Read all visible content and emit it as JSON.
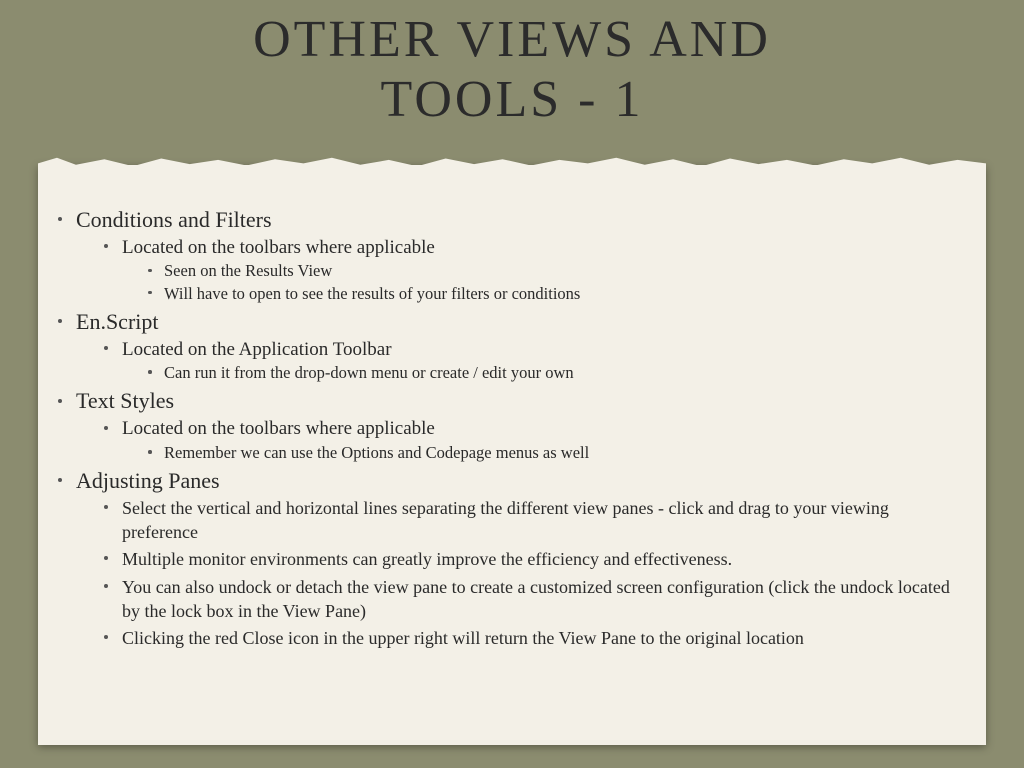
{
  "title_line1": "OTHER VIEWS AND",
  "title_line2": "TOOLS - 1",
  "sections": {
    "s1": {
      "heading": "Conditions and Filters",
      "sub1": "Located on the toolbars where applicable",
      "sub1_a": "Seen on the Results View",
      "sub1_b": "Will have to open to see the results of your filters or conditions"
    },
    "s2": {
      "heading": "En.Script",
      "sub1": "Located on the Application Toolbar",
      "sub1_a": "Can run it from the drop-down menu or create / edit your own"
    },
    "s3": {
      "heading": "Text Styles",
      "sub1": "Located on the toolbars where applicable",
      "sub1_a": "Remember we can use the Options and Codepage menus as well"
    },
    "s4": {
      "heading": "Adjusting Panes",
      "p1": "Select the vertical and horizontal lines separating the different view panes - click and drag to your viewing preference",
      "p2": "Multiple monitor environments can greatly improve the efficiency and effectiveness.",
      "p3": "You can also undock or detach the view pane to create a customized screen configuration (click the undock located by the lock box in the View Pane)",
      "p4": "Clicking the red Close icon in the upper right will return the View Pane to the original location"
    }
  }
}
